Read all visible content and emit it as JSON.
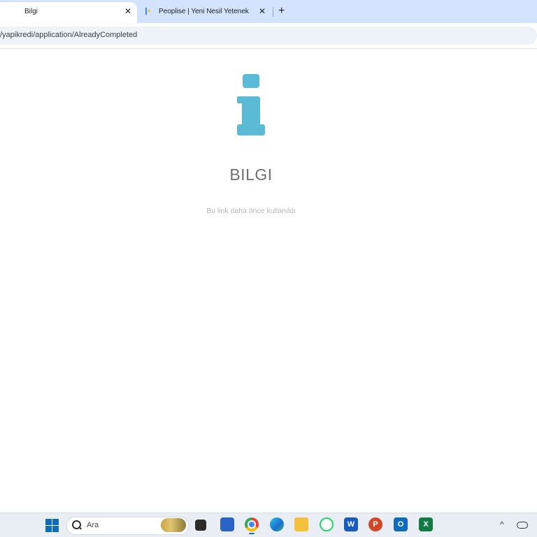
{
  "browser": {
    "tabs": [
      {
        "label": "Bilgi",
        "active": true
      },
      {
        "label": "Peoplise | Yeni Nesil Yetenek Ka",
        "active": false
      }
    ],
    "new_tab_glyph": "+",
    "close_glyph": "✕",
    "url": "/yapikredi/application/AlreadyCompleted"
  },
  "page": {
    "icon": "info-icon",
    "icon_color": "#5bbad5",
    "heading": "BILGI",
    "message": "Bu link daha önce kullanıldı"
  },
  "taskbar": {
    "search_placeholder": "Ara",
    "apps": [
      "start",
      "search",
      "file-explorer",
      "teams",
      "chrome",
      "edge",
      "files",
      "whatsapp",
      "word",
      "powerpoint",
      "outlook",
      "excel"
    ],
    "tray_chevron": "^"
  }
}
